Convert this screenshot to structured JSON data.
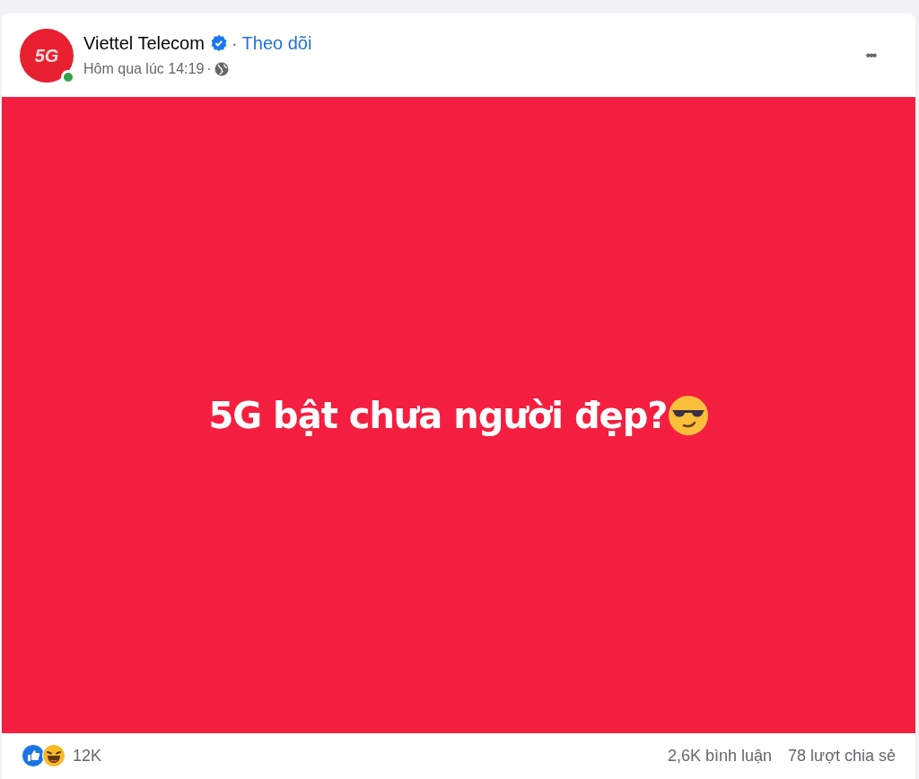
{
  "post": {
    "author": "Viettel Telecom",
    "verified": true,
    "separator": "·",
    "follow_label": "Theo dõi",
    "avatar_text": "5G",
    "online": true,
    "time": "Hôm qua lúc 14:19",
    "time_separator": "·",
    "more_label": "•••",
    "body_text": "5G bật chưa người đẹp?",
    "reactions_count": "12K",
    "comments": "2,6K bình luận",
    "shares": "78 lượt chia sẻ"
  }
}
